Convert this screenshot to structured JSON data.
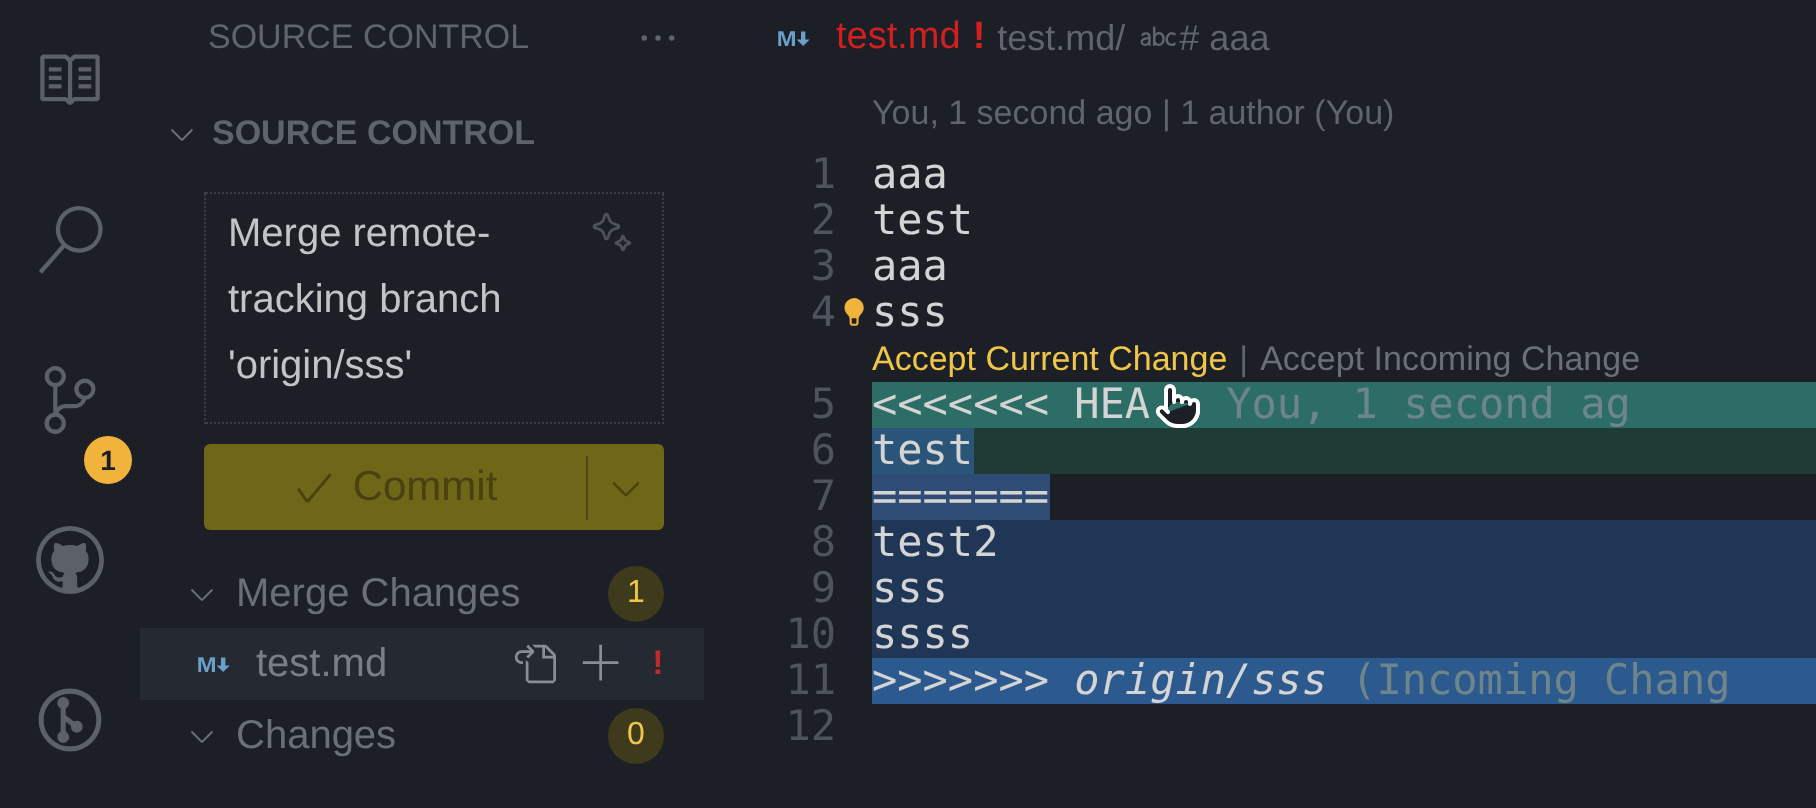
{
  "activity_bar": [
    {
      "kind": "explorer"
    },
    {
      "kind": "search"
    },
    {
      "kind": "source-control",
      "badge": "1"
    },
    {
      "kind": "github"
    },
    {
      "kind": "gitlens"
    }
  ],
  "sidebar": {
    "title": "SOURCE CONTROL",
    "section": {
      "title": "SOURCE CONTROL",
      "expanded": true
    },
    "commit_message": "Merge remote-tracking branch 'origin/sss'",
    "commit_button": {
      "label": "Commit"
    },
    "groups": [
      {
        "title": "Merge Changes",
        "count": "1",
        "expanded": true,
        "files": [
          {
            "name": "test.md",
            "status": "!",
            "kind": "markdown",
            "selected": true
          }
        ]
      },
      {
        "title": "Changes",
        "count": "0",
        "expanded": true
      }
    ]
  },
  "editor": {
    "tab": {
      "title": "test.md",
      "status": "!",
      "kind": "markdown"
    },
    "breadcrumbs": [
      {
        "text": "test.md/",
        "kind": "file"
      },
      {
        "text": "# aaa",
        "kind": "string"
      }
    ],
    "blame_header": "You, 1 second ago | 1 author (You)",
    "codelens": {
      "separator": "|",
      "actions": [
        {
          "label": "Accept Current Change",
          "hovered": true
        },
        {
          "label": "Accept Incoming Change",
          "hovered": false
        }
      ]
    },
    "lines": [
      {
        "number": "1",
        "text": "aaa",
        "kind": "normal"
      },
      {
        "number": "2",
        "text": "test",
        "kind": "normal"
      },
      {
        "number": "3",
        "text": "aaa",
        "kind": "normal"
      },
      {
        "number": "4",
        "text": "sss",
        "kind": "normal",
        "lightbulb": true
      },
      {
        "number": "5",
        "text": "<<<<<<< HEA",
        "kind": "current-marker",
        "ghost": "You, 1 second ag",
        "cursor": true
      },
      {
        "number": "6",
        "text": "test",
        "kind": "current"
      },
      {
        "number": "7",
        "text": "=======",
        "kind": "separator"
      },
      {
        "number": "8",
        "text": "test2",
        "kind": "incoming"
      },
      {
        "number": "9",
        "text": "sss",
        "kind": "incoming"
      },
      {
        "number": "10",
        "text": "ssss",
        "kind": "incoming"
      },
      {
        "number": "11",
        "text": ">>>>>>> *origin/sss*",
        "kind": "incoming-marker",
        "ghost": "(Incoming Chang"
      },
      {
        "number": "12",
        "kind": "normal"
      }
    ]
  }
}
